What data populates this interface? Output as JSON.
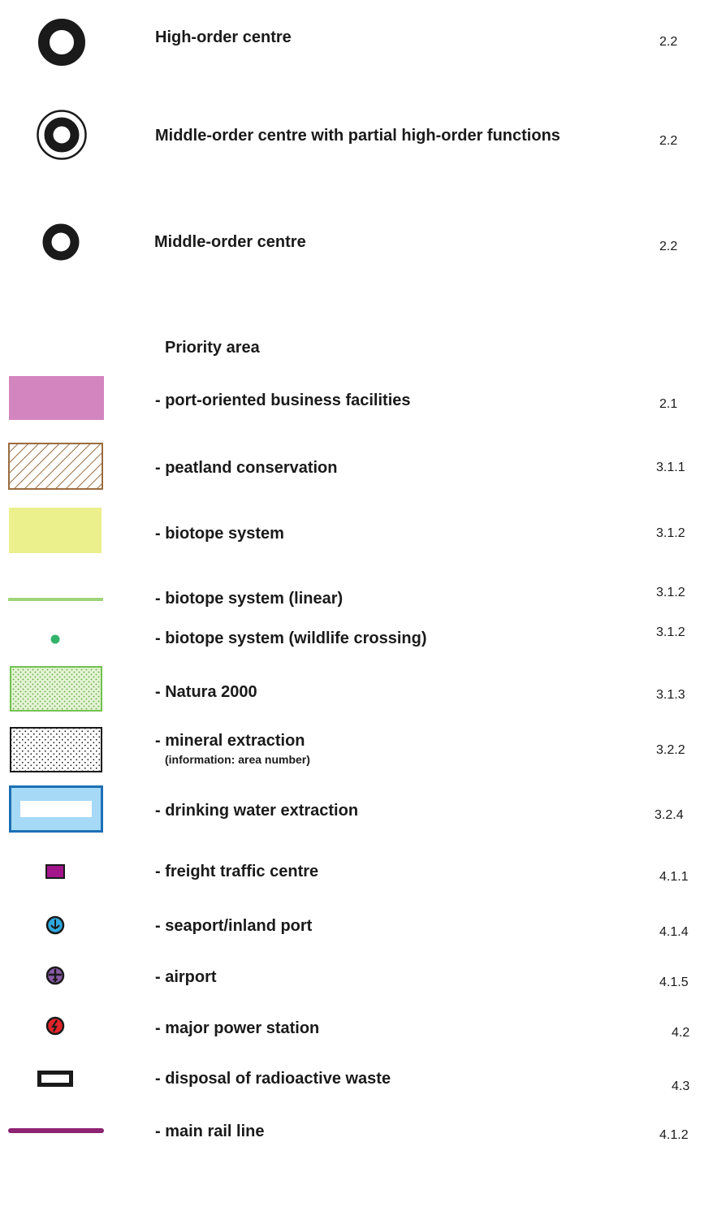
{
  "legend": {
    "centres": [
      {
        "label": "High-order centre",
        "ref": "2.2",
        "symbol": "thick-ring-icon"
      },
      {
        "label": "Middle-order centre with partial high-order functions",
        "ref": "2.2",
        "symbol": "double-ring-icon"
      },
      {
        "label": "Middle-order centre",
        "ref": "2.2",
        "symbol": "ring-icon"
      }
    ],
    "priority_heading": "Priority area",
    "priority_items": [
      {
        "label": "- port-oriented business facilities",
        "ref": "2.1",
        "symbol": "pink-area-swatch",
        "color": "#d385bf"
      },
      {
        "label": "- peatland conservation",
        "ref": "3.1.1",
        "symbol": "brown-hatch-swatch",
        "color": "#9b6c3e"
      },
      {
        "label": "- biotope system",
        "ref": "3.1.2",
        "symbol": "yellow-area-swatch",
        "color": "#ebef8c"
      },
      {
        "label": "- biotope system (linear)",
        "ref": "3.1.2",
        "symbol": "green-line-symbol",
        "color": "#9ed57a"
      },
      {
        "label": "- biotope system (wildlife crossing)",
        "ref": "3.1.2",
        "symbol": "green-dot-symbol",
        "color": "#33b36b"
      },
      {
        "label": "- Natura 2000",
        "ref": "3.1.3",
        "symbol": "green-dotted-swatch",
        "color": "#72c250"
      },
      {
        "label": "- mineral extraction",
        "sublabel": "(information: area number)",
        "ref": "3.2.2",
        "symbol": "black-dotted-swatch",
        "color": "#1a1a1a"
      },
      {
        "label": "- drinking water extraction",
        "ref": "3.2.4",
        "symbol": "blue-frame-swatch",
        "color": "#1d6fb5"
      },
      {
        "label": "- freight traffic centre",
        "ref": "4.1.1",
        "symbol": "purple-rect-icon",
        "color": "#a3158a"
      },
      {
        "label": "- seaport/inland port",
        "ref": "4.1.4",
        "symbol": "anchor-icon",
        "color": "#2fa8e0"
      },
      {
        "label": "- airport",
        "ref": "4.1.5",
        "symbol": "airplane-icon",
        "color": "#8a5aa6"
      },
      {
        "label": "- major power station",
        "ref": "4.2",
        "symbol": "power-icon",
        "color": "#e2242a"
      },
      {
        "label": "- disposal of radioactive waste",
        "ref": "4.3",
        "symbol": "black-frame-icon",
        "color": "#1a1a1a"
      },
      {
        "label": "- main rail line",
        "ref": "4.1.2",
        "symbol": "purple-line-symbol",
        "color": "#8e2273"
      }
    ]
  }
}
